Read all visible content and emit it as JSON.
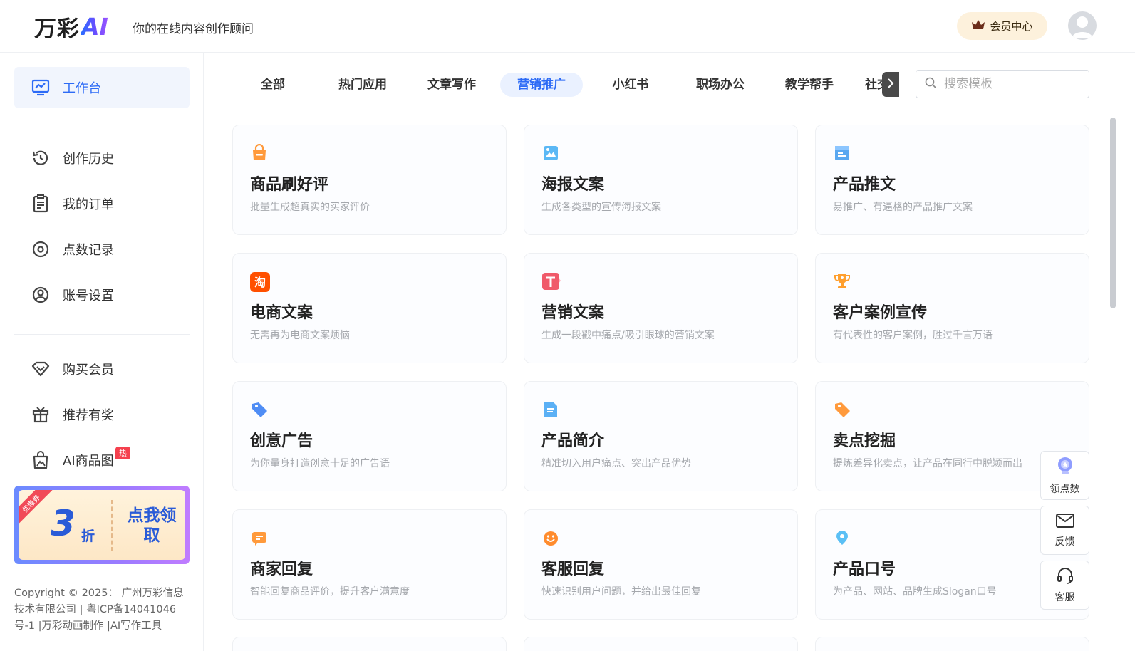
{
  "header": {
    "logo_cn": "万彩",
    "logo_ai": "AI",
    "tagline": "你的在线内容创作顾问",
    "vip_label": "会员中心"
  },
  "sidebar": {
    "items": [
      {
        "label": "工作台",
        "icon": "dashboard-icon",
        "active": true
      },
      {
        "label": "创作历史",
        "icon": "history-icon"
      },
      {
        "label": "我的订单",
        "icon": "order-icon"
      },
      {
        "label": "点数记录",
        "icon": "points-icon"
      },
      {
        "label": "账号设置",
        "icon": "account-icon"
      },
      {
        "label": "购买会员",
        "icon": "diamond-icon"
      },
      {
        "label": "推荐有奖",
        "icon": "gift-icon"
      },
      {
        "label": "AI商品图",
        "icon": "product-image-icon"
      }
    ],
    "hot_badge": "热",
    "promo": {
      "ribbon": "优惠券",
      "number": "3",
      "unit": "折",
      "cta": "点我领取"
    },
    "footer": "Copyright © 2025： 广州万彩信息技术有限公司 | 粤ICP备14041046号-1 |万彩动画制作 |AI写作工具"
  },
  "tabs": [
    "全部",
    "热门应用",
    "文章写作",
    "营销推广",
    "小红书",
    "职场办公",
    "教学帮手",
    "社交"
  ],
  "active_tab": "营销推广",
  "search": {
    "placeholder": "搜索模板"
  },
  "cards": [
    {
      "title": "商品刷好评",
      "desc": "批量生成超真实的买家评价",
      "icon": "shopping-bag-icon"
    },
    {
      "title": "海报文案",
      "desc": "生成各类型的宣传海报文案",
      "icon": "poster-icon"
    },
    {
      "title": "产品推文",
      "desc": "易推广、有逼格的产品推广文案",
      "icon": "product-post-icon"
    },
    {
      "title": "电商文案",
      "desc": "无需再为电商文案烦恼",
      "icon": "taobao-icon"
    },
    {
      "title": "营销文案",
      "desc": "生成一段戳中痛点/吸引眼球的营销文案",
      "icon": "text-t-icon"
    },
    {
      "title": "客户案例宣传",
      "desc": "有代表性的客户案例，胜过千言万语",
      "icon": "trophy-icon"
    },
    {
      "title": "创意广告",
      "desc": "为你量身打造创意十足的广告语",
      "icon": "tag-blue-icon"
    },
    {
      "title": "产品简介",
      "desc": "精准切入用户痛点、突出产品优势",
      "icon": "document-icon"
    },
    {
      "title": "卖点挖掘",
      "desc": "提炼差异化卖点，让产品在同行中脱颖而出",
      "icon": "tag-orange-icon"
    },
    {
      "title": "商家回复",
      "desc": "智能回复商品评价，提升客户满意度",
      "icon": "chat-icon"
    },
    {
      "title": "客服回复",
      "desc": "快速识别用户问题，并给出最佳回复",
      "icon": "smile-icon"
    },
    {
      "title": "产品口号",
      "desc": "为产品、网站、品牌生成Slogan口号",
      "icon": "location-icon"
    }
  ],
  "float_buttons": [
    {
      "label": "领点数",
      "icon": "points-badge-icon"
    },
    {
      "label": "反馈",
      "icon": "mail-icon"
    },
    {
      "label": "客服",
      "icon": "headset-icon"
    }
  ],
  "colors": {
    "accent": "#2d6bf6",
    "active_bg": "#f1f5fd",
    "vip_bg": "#fdf1dc"
  }
}
